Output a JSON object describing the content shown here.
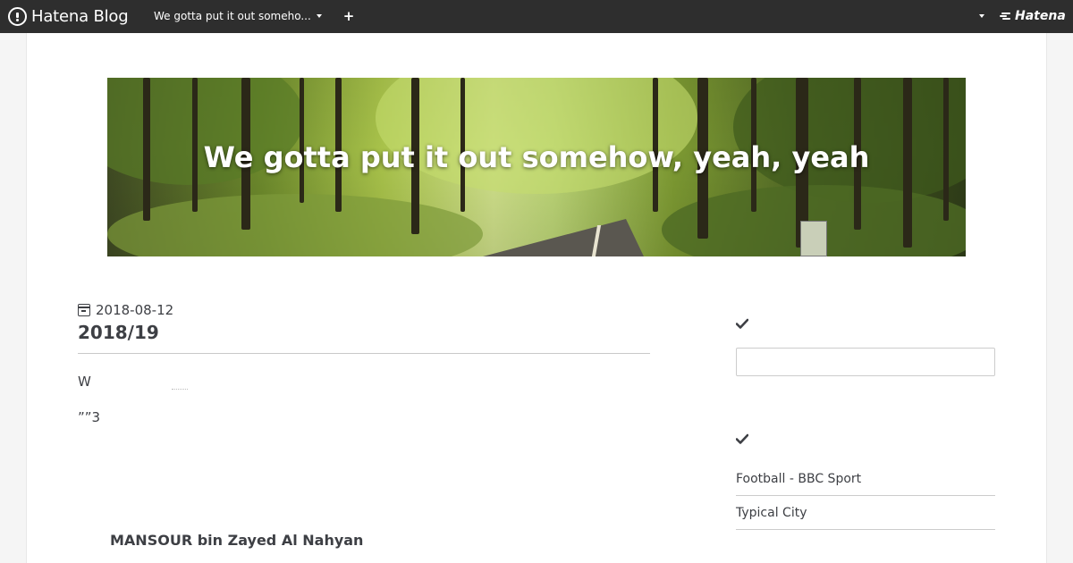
{
  "topbar": {
    "brand": "Hatena Blog",
    "blog_selector": "We gotta put it out someho...",
    "add_label": "+",
    "hatena_label": "Hatena"
  },
  "header": {
    "title": "We gotta put it out somehow, yeah, yeah"
  },
  "entry": {
    "date": "2018-08-12",
    "title": "2018/19",
    "line1": "W",
    "line2": "””3",
    "name": "MANSOUR bin Zayed Al Nahyan"
  },
  "sidebar": {
    "search": {
      "value": ""
    },
    "links": [
      {
        "label": "Football - BBC Sport"
      },
      {
        "label": "Typical City"
      }
    ]
  },
  "colors": {
    "topbar_bg": "#2e2e2e",
    "text": "#3d3f44",
    "page_bg": "#ffffff"
  }
}
